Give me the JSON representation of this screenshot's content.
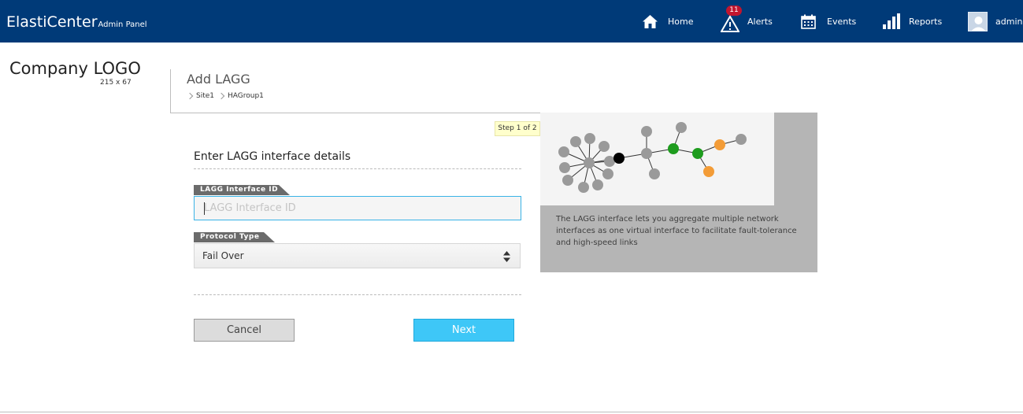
{
  "header": {
    "brand": "ElastiCenter",
    "brand_sub": "Admin Panel",
    "nav": {
      "home": "Home",
      "alerts": "Alerts",
      "alerts_count": "11",
      "events": "Events",
      "reports": "Reports",
      "user": "admin"
    }
  },
  "logo": {
    "text": "Company LOGO",
    "size": "215 x 67"
  },
  "page": {
    "title": "Add LAGG",
    "breadcrumb": [
      "Site1",
      "HAGroup1"
    ],
    "step": "Step 1 of 2"
  },
  "form": {
    "heading": "Enter LAGG interface details",
    "lagg_id_label": "LAGG Interface ID",
    "lagg_id_placeholder": "LAGG Interface ID",
    "lagg_id_value": "",
    "protocol_label": "Protocol Type",
    "protocol_value": "Fail Over",
    "cancel": "Cancel",
    "next": "Next"
  },
  "info": {
    "text": "The LAGG interface lets you aggregate multiple network interfaces as one virtual interface to facilitate fault-tolerance and high-speed links"
  },
  "colors": {
    "header_bg": "#003a78",
    "badge": "#c0152f",
    "accent": "#3ec7f7",
    "node_gray": "#9a9a9a",
    "node_black": "#000000",
    "node_green": "#1e9c1e",
    "node_orange": "#f39c37"
  }
}
